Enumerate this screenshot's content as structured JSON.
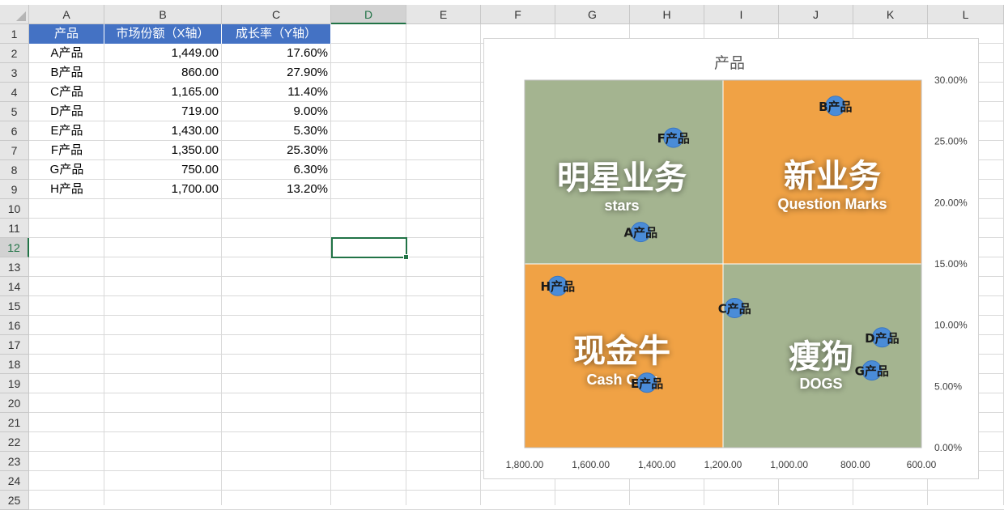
{
  "columns": [
    "A",
    "B",
    "C",
    "D",
    "E",
    "F",
    "G",
    "H",
    "I",
    "J",
    "K",
    "L"
  ],
  "rows": [
    "1",
    "2",
    "3",
    "4",
    "5",
    "6",
    "7",
    "8",
    "9",
    "10",
    "11",
    "12",
    "13",
    "14",
    "15",
    "16",
    "17",
    "18",
    "19",
    "20",
    "21",
    "22",
    "23",
    "24",
    "25"
  ],
  "selected_column": "D",
  "selected_row": "12",
  "active_cell": "D12",
  "table": {
    "headers": [
      "产品",
      "市场份额（X轴）",
      "成长率（Y轴）"
    ],
    "rows": [
      [
        "A产品",
        "1,449.00",
        "17.60%"
      ],
      [
        "B产品",
        "860.00",
        "27.90%"
      ],
      [
        "C产品",
        "1,165.00",
        "11.40%"
      ],
      [
        "D产品",
        "719.00",
        "9.00%"
      ],
      [
        "E产品",
        "1,430.00",
        "5.30%"
      ],
      [
        "F产品",
        "1,350.00",
        "25.30%"
      ],
      [
        "G产品",
        "750.00",
        "6.30%"
      ],
      [
        "H产品",
        "1,700.00",
        "13.20%"
      ]
    ]
  },
  "colors": {
    "header_fill": "#4472c4",
    "quadrant_green": "#a4b490",
    "quadrant_orange": "#f0a245",
    "point": "#4a8cd8",
    "selection": "#217346"
  },
  "chart_data": {
    "type": "scatter",
    "title": "产品",
    "x_reversed": true,
    "xlim": [
      600,
      1800
    ],
    "ylim": [
      0,
      0.3
    ],
    "x_divider": 1200,
    "y_divider": 0.15,
    "x_ticks": [
      1800,
      1600,
      1400,
      1200,
      1000,
      800,
      600
    ],
    "x_tick_labels": [
      "1,800.00",
      "1,600.00",
      "1,400.00",
      "1,200.00",
      "1,000.00",
      "800.00",
      "600.00"
    ],
    "y_ticks": [
      0,
      0.05,
      0.1,
      0.15,
      0.2,
      0.25,
      0.3
    ],
    "y_tick_labels": [
      "0.00%",
      "5.00%",
      "10.00%",
      "15.00%",
      "20.00%",
      "25.00%",
      "30.00%"
    ],
    "y_axis_position": "right",
    "points": [
      {
        "label": "A产品",
        "x": 1449,
        "y": 0.176
      },
      {
        "label": "B产品",
        "x": 860,
        "y": 0.279
      },
      {
        "label": "C产品",
        "x": 1165,
        "y": 0.114
      },
      {
        "label": "D产品",
        "x": 719,
        "y": 0.09
      },
      {
        "label": "E产品",
        "x": 1430,
        "y": 0.053
      },
      {
        "label": "F产品",
        "x": 1350,
        "y": 0.253
      },
      {
        "label": "G产品",
        "x": 750,
        "y": 0.063
      },
      {
        "label": "H产品",
        "x": 1700,
        "y": 0.132
      }
    ],
    "quadrants": [
      {
        "position": "top-left",
        "title": "明星业务",
        "subtitle": "stars",
        "color": "#a4b490"
      },
      {
        "position": "top-right",
        "title": "新业务",
        "subtitle": "Question Marks",
        "color": "#f0a245"
      },
      {
        "position": "bottom-left",
        "title": "现金牛",
        "subtitle": "Cash Cow",
        "color": "#f0a245"
      },
      {
        "position": "bottom-right",
        "title": "瘦狗",
        "subtitle": "DOGS",
        "color": "#a4b490"
      }
    ]
  }
}
